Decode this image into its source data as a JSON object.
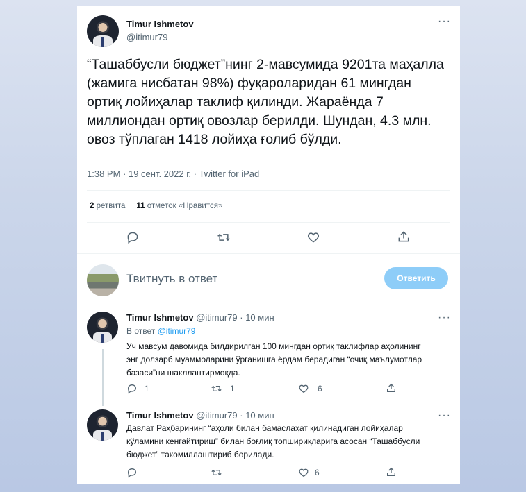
{
  "main_tweet": {
    "author_name": "Timur Ishmetov",
    "author_handle": "@itimur79",
    "text": "“Ташаббусли бюджет”нинг 2-мавсумида 9201та маҳалла (жамига нисбатан 98%) фуқароларидан 61 мингдан ортиқ лойиҳалар таклиф қилинди. Жараёнда 7 миллиондан ортиқ овозлар берилди. Шундан, 4.3 млн. овоз тўплаган 1418 лойиҳа ғолиб бўлди.",
    "meta": "1:38 PM · 19 сент. 2022 г. · Twitter for iPad",
    "retweets_count": "2",
    "retweets_label": "ретвита",
    "likes_count": "11",
    "likes_label": "отметок «Нравится»"
  },
  "reply_box": {
    "placeholder": "Твитнуть в ответ",
    "button_label": "Ответить"
  },
  "replies": [
    {
      "author_name": "Timur Ishmetov",
      "author_handle": "@itimur79",
      "time": "· 10 мин",
      "replying_prefix": "В ответ",
      "replying_to": "@itimur79",
      "text": "Уч мавсум давомида билдирилган 100 мингдан ортиқ таклифлар аҳолининг энг долзарб муаммоларини  ўрганишга ёрдам берадиган “очиқ маълумотлар базаси”ни шакллантирмоқда.",
      "reply_count": "1",
      "retweet_count": "1",
      "like_count": "6"
    },
    {
      "author_name": "Timur Ishmetov",
      "author_handle": "@itimur79",
      "time": "· 10 мин",
      "text": "Давлат Раҳбарининг “аҳоли билан бамаслаҳат қилинадиган лойиҳалар кўламини кенгайтириш” билан боғлиқ топшириқларига асосан “Ташаббусли бюджет” такомиллаштириб борилади.",
      "like_count": "6"
    }
  ],
  "icons": [
    "more-icon",
    "reply-icon",
    "retweet-icon",
    "like-icon",
    "share-icon"
  ],
  "colors": {
    "accent": "#1d9bf0",
    "button_disabled": "#8ecdf8",
    "muted_text": "#536471"
  }
}
